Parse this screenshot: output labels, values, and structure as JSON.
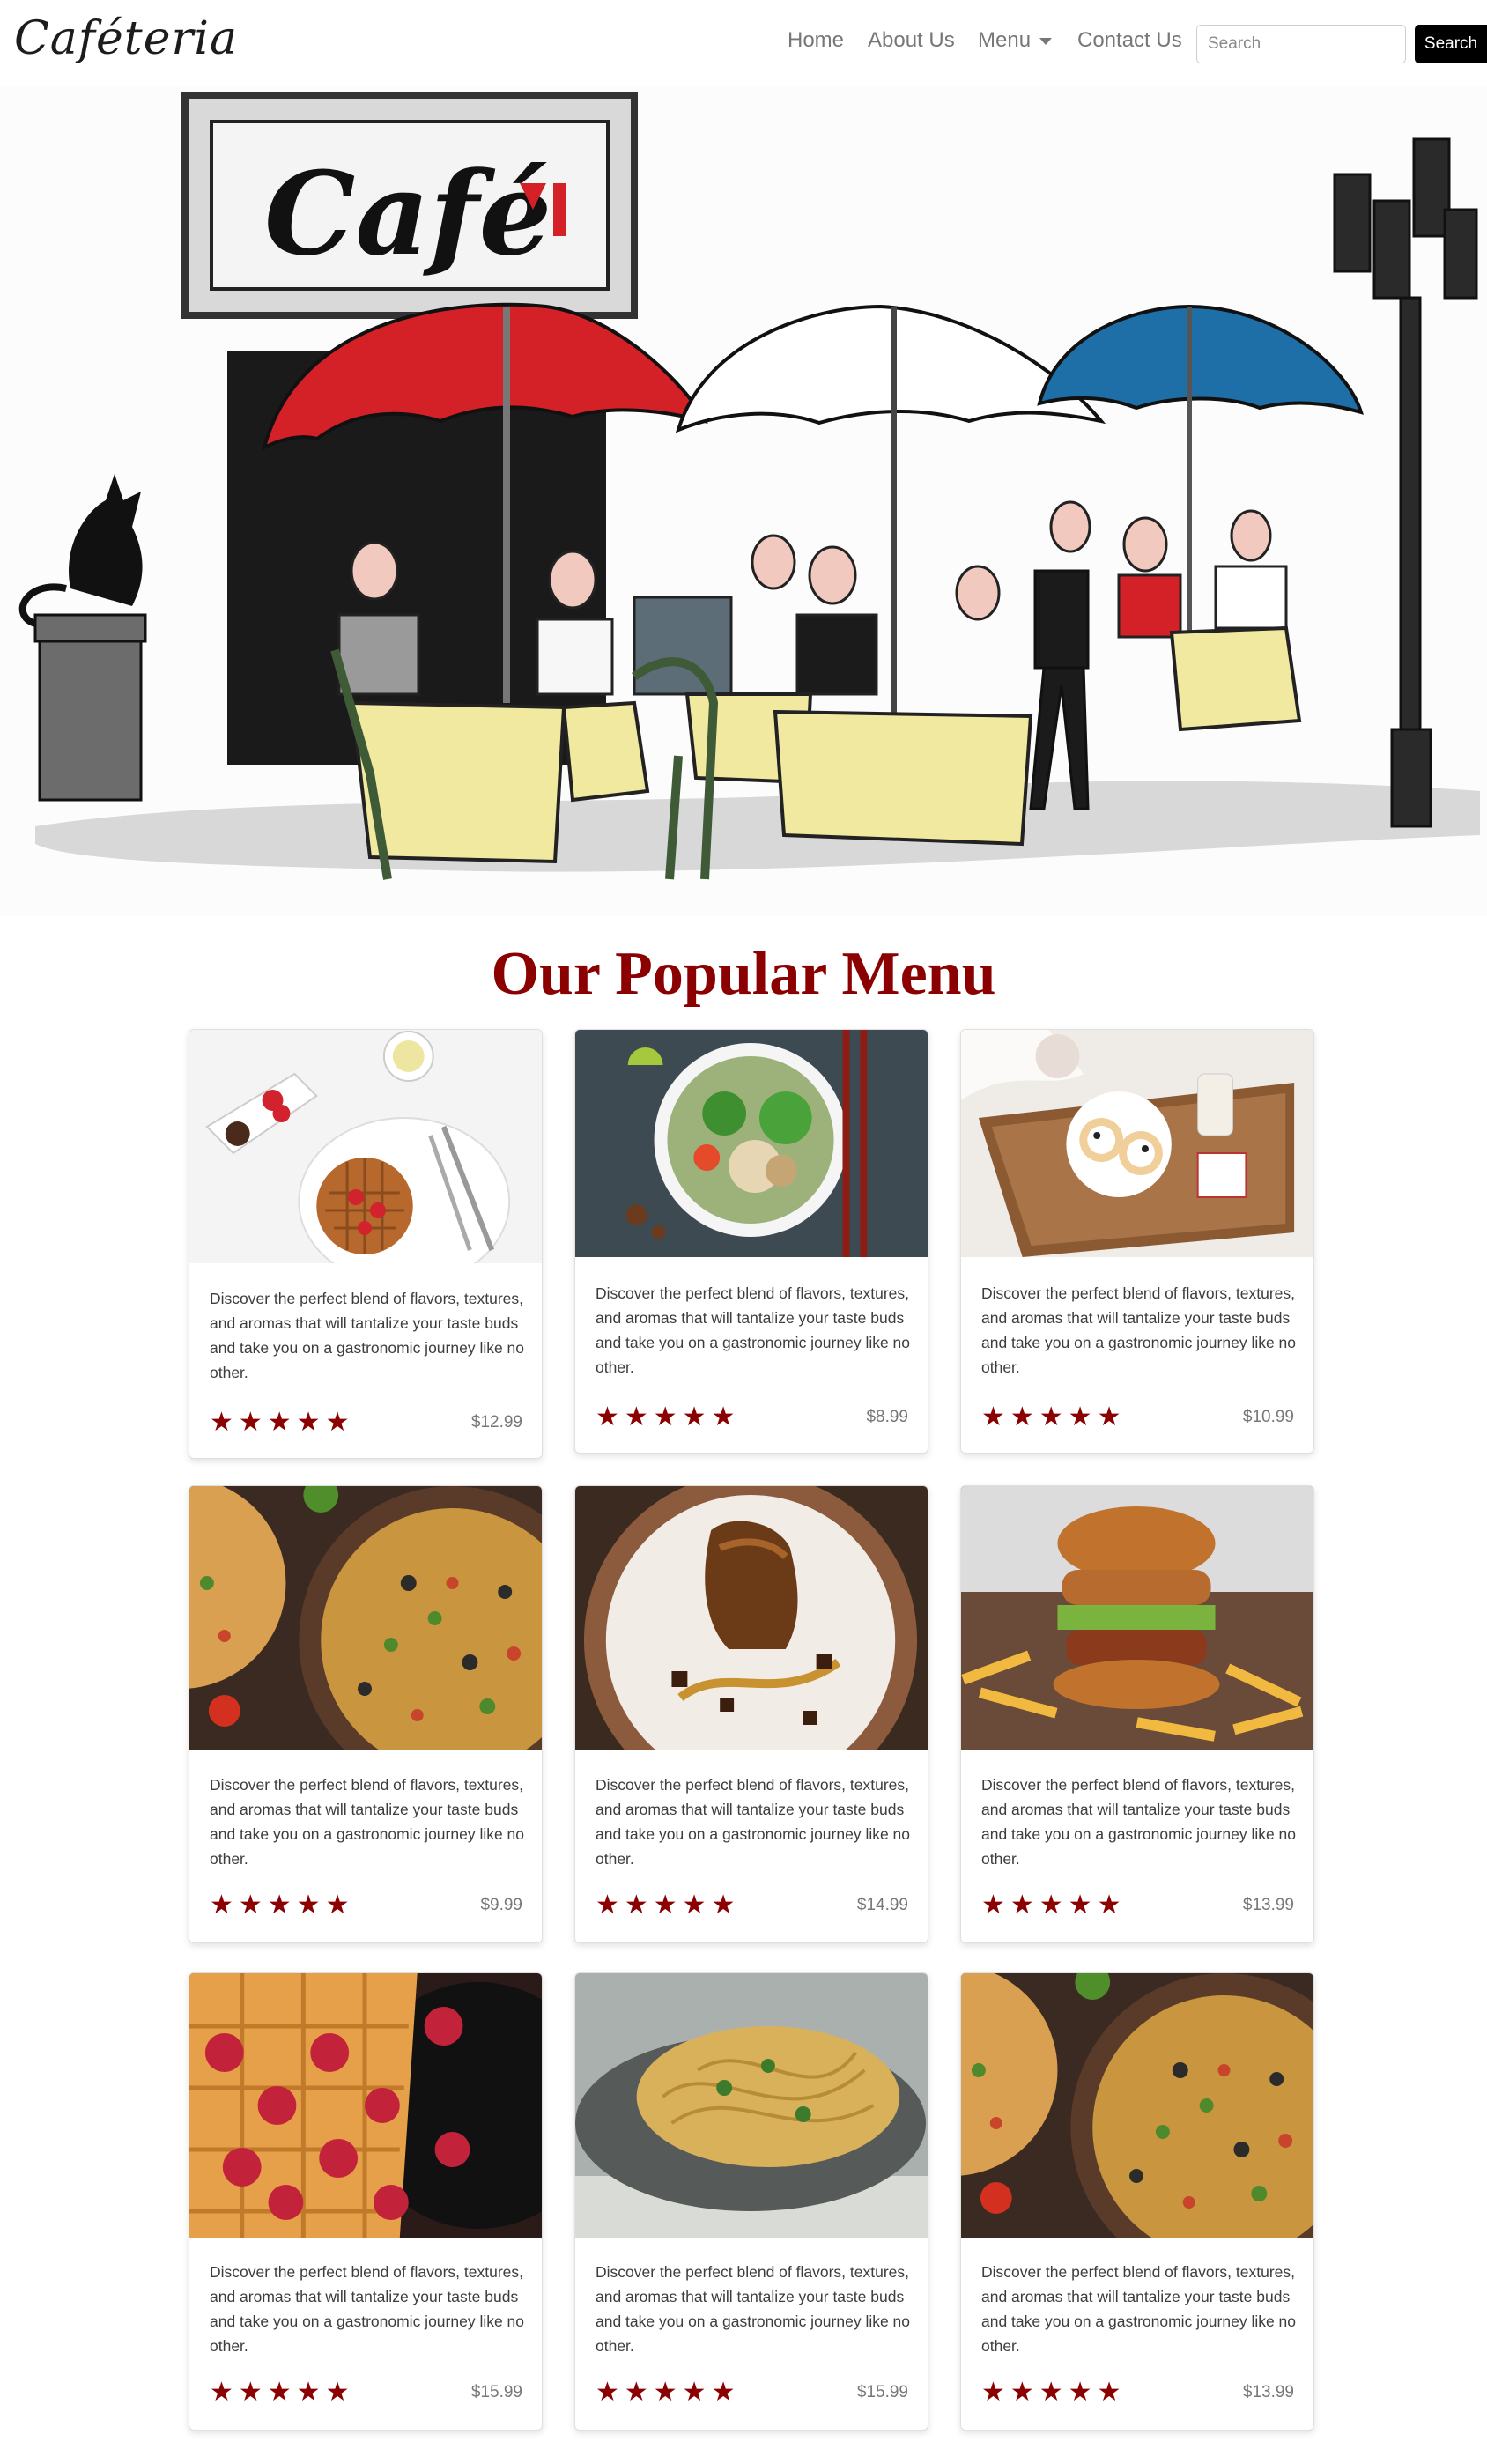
{
  "navbar": {
    "brand": "Caféteria",
    "links": [
      "Home",
      "About Us",
      "Menu",
      "Contact Us"
    ],
    "search_placeholder": "Search",
    "search_button": "Search"
  },
  "hero": {
    "sign_text": "Café",
    "colors": {
      "red_umbrella": "#d42128",
      "blue_umbrella": "#1e6fa8",
      "table_cloth": "#f2e9a0",
      "chair": "#3f5a36"
    }
  },
  "menu": {
    "title": "Our Popular Menu",
    "description": "Discover the perfect blend of flavors, textures, and aromas that will tantalize your taste buds and take you on a gastronomic journey like no other.",
    "stars": "★★★★★",
    "rating": 5,
    "items": [
      {
        "image": "waffle-strawberry-plate",
        "price": "$12.99"
      },
      {
        "image": "salad-bowl",
        "price": "$8.99"
      },
      {
        "image": "cookies-tray",
        "price": "$10.99"
      },
      {
        "image": "pizza",
        "price": "$9.99"
      },
      {
        "image": "chocolate-cake",
        "price": "$14.99"
      },
      {
        "image": "burger-fries",
        "price": "$13.99"
      },
      {
        "image": "waffle-raspberries",
        "price": "$15.99"
      },
      {
        "image": "spaghetti",
        "price": "$15.99"
      },
      {
        "image": "pizza",
        "price": "$13.99"
      }
    ]
  },
  "colors": {
    "accent": "#8b0000",
    "search_button": "#000000"
  }
}
